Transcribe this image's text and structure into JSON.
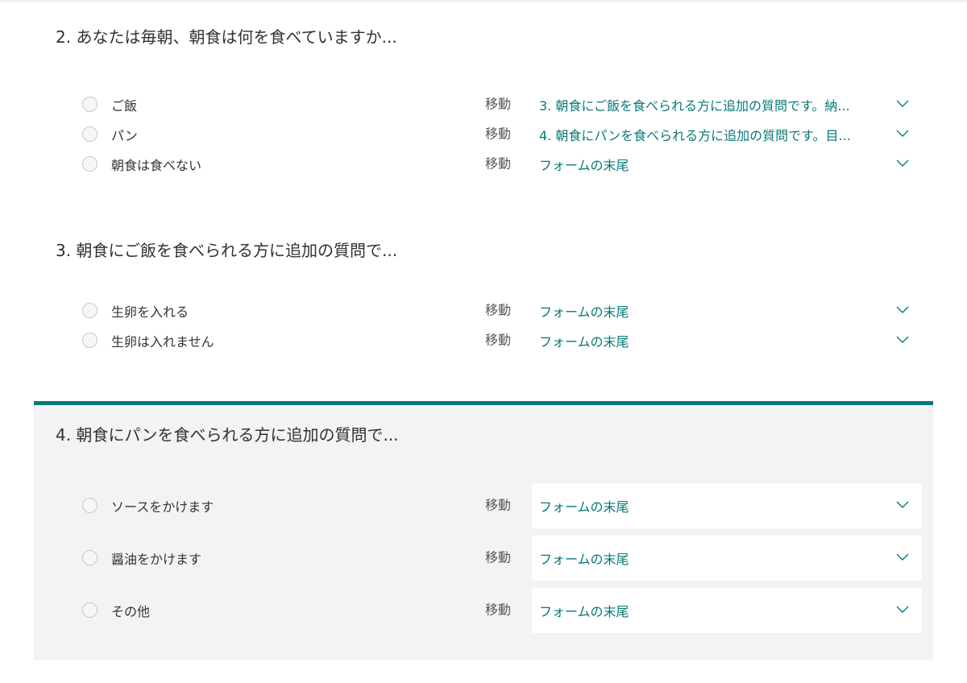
{
  "move_label": "移動",
  "accent_color": "#077976",
  "questions": [
    {
      "title": "2. あなたは毎朝、朝食は何を食べていますか...",
      "options": [
        {
          "label": "ご飯",
          "branch": "3. 朝食にご飯を食べられる方に追加の質問です。納..."
        },
        {
          "label": "パン",
          "branch": "4. 朝食にパンを食べられる方に追加の質問です。目..."
        },
        {
          "label": "朝食は食べない",
          "branch": "フォームの末尾"
        }
      ]
    },
    {
      "title": "3. 朝食にご飯を食べられる方に追加の質問で...",
      "options": [
        {
          "label": "生卵を入れる",
          "branch": "フォームの末尾"
        },
        {
          "label": "生卵は入れません",
          "branch": "フォームの末尾"
        }
      ]
    },
    {
      "title": "4. 朝食にパンを食べられる方に追加の質問で...",
      "selected": true,
      "options": [
        {
          "label": "ソースをかけます",
          "branch": "フォームの末尾"
        },
        {
          "label": "醤油をかけます",
          "branch": "フォームの末尾"
        },
        {
          "label": "その他",
          "branch": "フォームの末尾"
        }
      ]
    }
  ]
}
